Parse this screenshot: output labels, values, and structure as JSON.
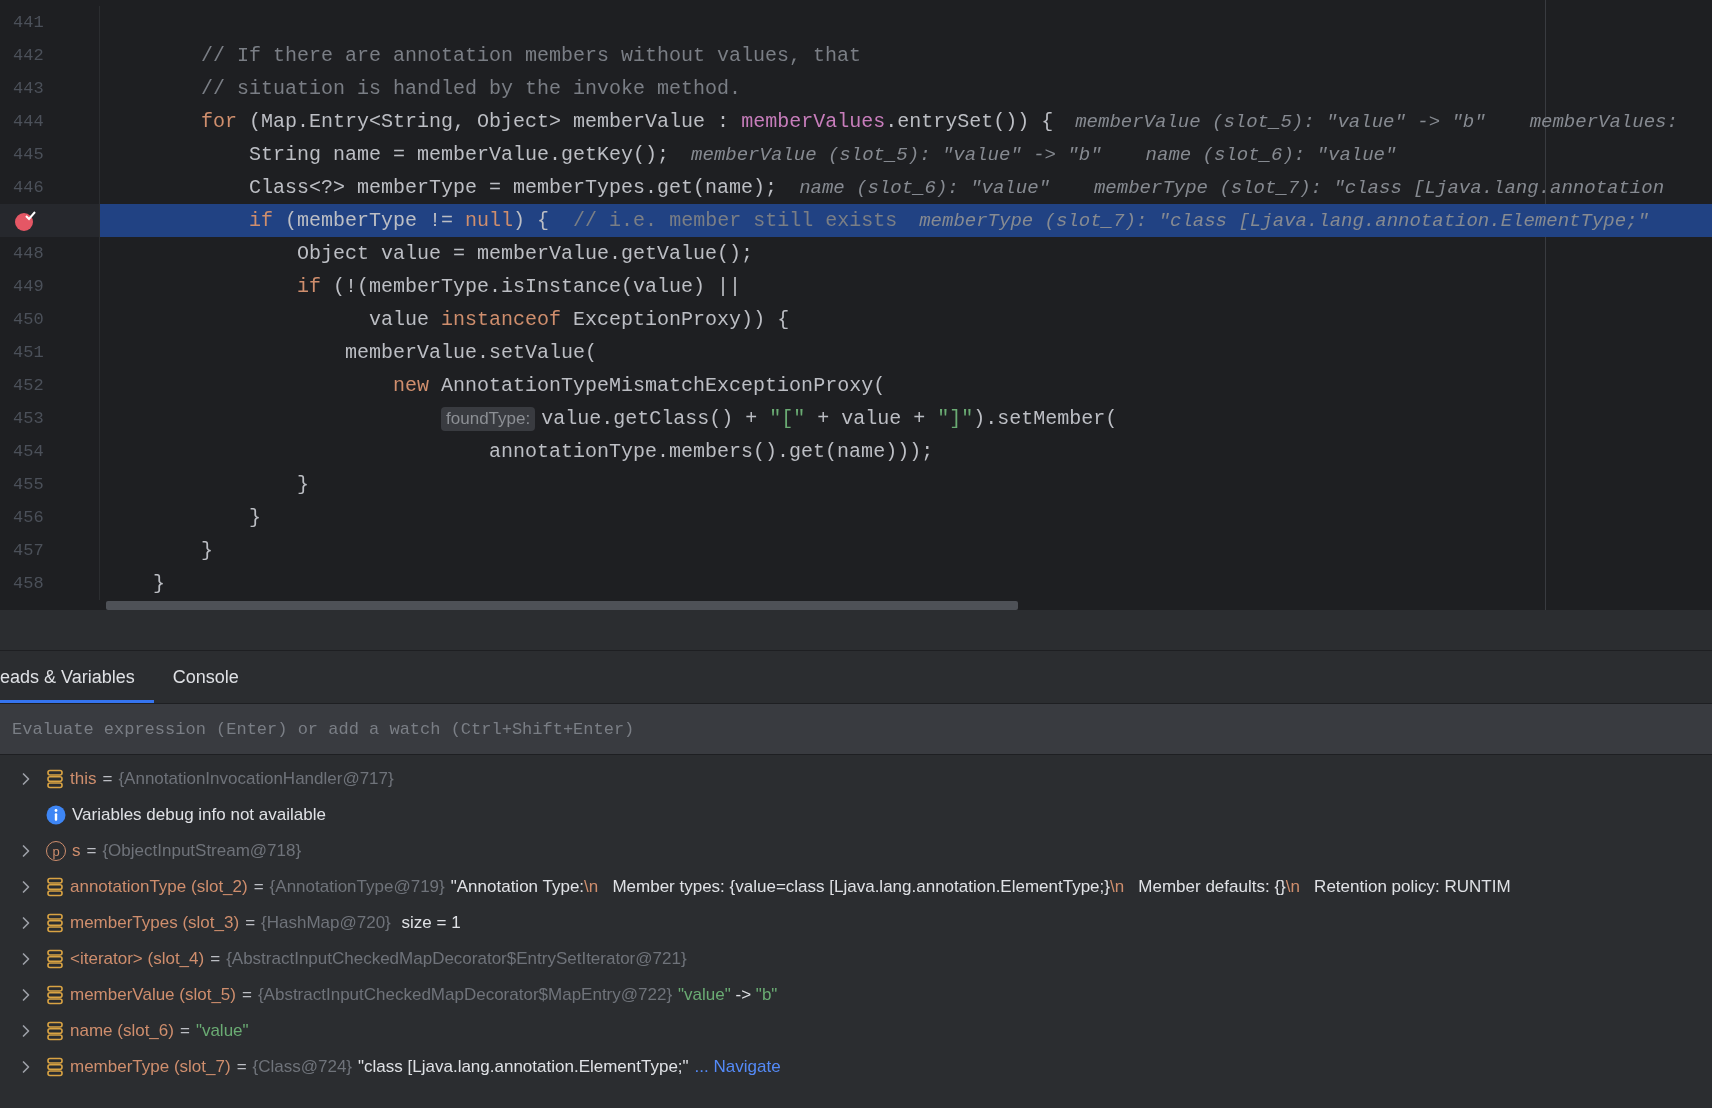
{
  "editor": {
    "lines": [
      {
        "number": "441",
        "breakpoint": false,
        "current": false
      },
      {
        "number": "442",
        "breakpoint": false,
        "current": false,
        "tokens": [
          {
            "kind": "comment",
            "text": "        // If there are annotation members without values, that"
          }
        ]
      },
      {
        "number": "443",
        "breakpoint": false,
        "current": false,
        "tokens": [
          {
            "kind": "comment",
            "text": "        // situation is handled by the invoke method."
          }
        ]
      },
      {
        "number": "444",
        "breakpoint": false,
        "current": false,
        "tokens": [
          {
            "kind": "keyword",
            "text": "        for"
          },
          {
            "kind": "plain",
            "text": " (Map.Entry<String, Object> memberValue : "
          },
          {
            "kind": "field",
            "text": "memberValues"
          },
          {
            "kind": "plain",
            "text": ".entrySet()) {"
          },
          {
            "kind": "hint",
            "text": "memberValue (slot_5): \"value\" -> \"b\""
          },
          {
            "kind": "hint",
            "text": "memberValues:"
          }
        ]
      },
      {
        "number": "445",
        "breakpoint": false,
        "current": false,
        "tokens": [
          {
            "kind": "plain",
            "text": "            String name = memberValue.getKey();"
          },
          {
            "kind": "hint",
            "text": "memberValue (slot_5): \"value\" -> \"b\""
          },
          {
            "kind": "hint",
            "text": "name (slot_6): \"value\""
          }
        ]
      },
      {
        "number": "446",
        "breakpoint": false,
        "current": false,
        "tokens": [
          {
            "kind": "plain",
            "text": "            Class<?> memberType = memberTypes.get(name);"
          },
          {
            "kind": "hint",
            "text": "name (slot_6): \"value\""
          },
          {
            "kind": "hint",
            "text": "memberType (slot_7): \"class [Ljava.lang.annotation"
          }
        ]
      },
      {
        "breakpoint": true,
        "current": true,
        "tokens": [
          {
            "kind": "keyword",
            "text": "            if"
          },
          {
            "kind": "plain",
            "text": " (memberType != "
          },
          {
            "kind": "keyword",
            "text": "null"
          },
          {
            "kind": "plain",
            "text": ") {  "
          },
          {
            "kind": "comment",
            "text": "// i.e. member still exists"
          },
          {
            "kind": "hint",
            "text": "memberType (slot_7): \"class [Ljava.lang.annotation.ElementType;\""
          }
        ]
      },
      {
        "number": "448",
        "breakpoint": false,
        "current": false,
        "tokens": [
          {
            "kind": "plain",
            "text": "                Object value = memberValue.getValue();"
          }
        ]
      },
      {
        "number": "449",
        "breakpoint": false,
        "current": false,
        "tokens": [
          {
            "kind": "keyword",
            "text": "                if"
          },
          {
            "kind": "plain",
            "text": " (!(memberType.isInstance(value) ||"
          }
        ]
      },
      {
        "number": "450",
        "breakpoint": false,
        "current": false,
        "tokens": [
          {
            "kind": "plain",
            "text": "                      value "
          },
          {
            "kind": "keyword",
            "text": "instanceof"
          },
          {
            "kind": "plain",
            "text": " ExceptionProxy)) {"
          }
        ]
      },
      {
        "number": "451",
        "breakpoint": false,
        "current": false,
        "tokens": [
          {
            "kind": "plain",
            "text": "                    memberValue.setValue("
          }
        ]
      },
      {
        "number": "452",
        "breakpoint": false,
        "current": false,
        "tokens": [
          {
            "kind": "keyword",
            "text": "                        new"
          },
          {
            "kind": "plain",
            "text": " AnnotationTypeMismatchExceptionProxy("
          }
        ]
      },
      {
        "number": "453",
        "breakpoint": false,
        "current": false,
        "tokens": [
          {
            "kind": "inlay",
            "text": "                            foundType:"
          },
          {
            "kind": "plain",
            "text": "value.getClass() + "
          },
          {
            "kind": "string",
            "text": "\"[\""
          },
          {
            "kind": "plain",
            "text": " + value + "
          },
          {
            "kind": "string",
            "text": "\"]\""
          },
          {
            "kind": "plain",
            "text": ").setMember("
          }
        ]
      },
      {
        "number": "454",
        "breakpoint": false,
        "current": false,
        "tokens": [
          {
            "kind": "plain",
            "text": "                                annotationType.members().get(name)));"
          }
        ]
      },
      {
        "number": "455",
        "breakpoint": false,
        "current": false,
        "tokens": [
          {
            "kind": "plain",
            "text": "                }"
          }
        ]
      },
      {
        "number": "456",
        "breakpoint": false,
        "current": false,
        "tokens": [
          {
            "kind": "plain",
            "text": "            }"
          }
        ]
      },
      {
        "number": "457",
        "breakpoint": false,
        "current": false,
        "tokens": [
          {
            "kind": "plain",
            "text": "        }"
          }
        ]
      },
      {
        "number": "458",
        "breakpoint": false,
        "current": false,
        "tokens": [
          {
            "kind": "plain",
            "text": "    }"
          }
        ]
      }
    ]
  },
  "debugger": {
    "tabs": [
      {
        "label": "eads & Variables",
        "selected": true
      },
      {
        "label": "Console",
        "selected": false
      }
    ],
    "evaluate": {
      "placeholder": "Evaluate expression (Enter) or add a watch (Ctrl+Shift+Enter)"
    },
    "variables": [
      {
        "kind": "field",
        "expandable": true,
        "name": "this",
        "sep": "=",
        "ref": "{AnnotationInvocationHandler@717}"
      },
      {
        "kind": "info",
        "expandable": false,
        "text": "Variables debug info not available"
      },
      {
        "kind": "param",
        "badge": "p",
        "expandable": true,
        "name": "s",
        "sep": "=",
        "ref": "{ObjectInputStream@718}"
      },
      {
        "kind": "field",
        "expandable": true,
        "name": "annotationType (slot_2)",
        "sep": "=",
        "ref": "{AnnotationType@719}",
        "value": [
          {
            "kind": "text",
            "text": "\"Annotation Type:"
          },
          {
            "kind": "escape",
            "text": "\\n"
          },
          {
            "kind": "text",
            "text": "   Member types: {value=class [Ljava.lang.annotation.ElementType;}"
          },
          {
            "kind": "escape",
            "text": "\\n"
          },
          {
            "kind": "text",
            "text": "   Member defaults: {}"
          },
          {
            "kind": "escape",
            "text": "\\n"
          },
          {
            "kind": "text",
            "text": "   Retention policy: RUNTIM"
          }
        ]
      },
      {
        "kind": "field",
        "expandable": true,
        "name": "memberTypes (slot_3)",
        "sep": "=",
        "ref": "{HashMap@720}",
        "value": [
          {
            "kind": "text",
            "text": " size = 1"
          }
        ]
      },
      {
        "kind": "field",
        "expandable": true,
        "name": "<iterator> (slot_4)",
        "sep": "=",
        "ref": "{AbstractInputCheckedMapDecorator$EntrySetIterator@721}"
      },
      {
        "kind": "field",
        "expandable": true,
        "name": "memberValue (slot_5)",
        "sep": "=",
        "ref": "{AbstractInputCheckedMapDecorator$MapEntry@722}",
        "value": [
          {
            "kind": "string",
            "text": "\"value\""
          },
          {
            "kind": "text",
            "text": " -> "
          },
          {
            "kind": "string",
            "text": "\"b\""
          }
        ]
      },
      {
        "kind": "field",
        "expandable": true,
        "name": "name (slot_6)",
        "sep": "=",
        "value": [
          {
            "kind": "string",
            "text": "\"value\""
          }
        ]
      },
      {
        "kind": "field",
        "expandable": true,
        "name": "memberType (slot_7)",
        "sep": "=",
        "ref": "{Class@724}",
        "value": [
          {
            "kind": "text",
            "text": "\"class [Ljava.lang.annotation.ElementType;\""
          },
          {
            "kind": "link",
            "text": "... Navigate"
          }
        ]
      }
    ]
  }
}
